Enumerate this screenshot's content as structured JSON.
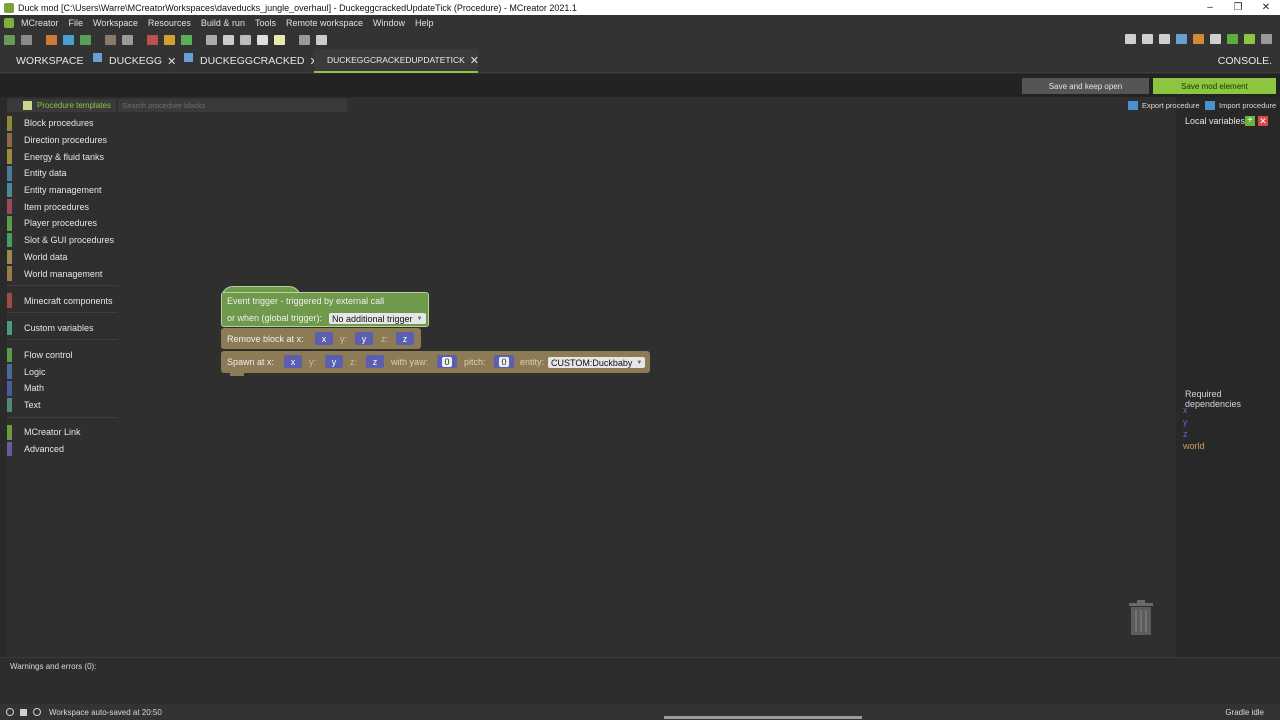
{
  "window": {
    "title": "Duck mod [C:\\Users\\Warre\\MCreatorWorkspaces\\daveducks_jungle_overhaul] - DuckeggcrackedUpdateTick (Procedure) - MCreator 2021.1"
  },
  "menu": [
    "MCreator",
    "File",
    "Workspace",
    "Resources",
    "Build & run",
    "Tools",
    "Remote workspace",
    "Window",
    "Help"
  ],
  "tabs": {
    "workspace": "WORKSPACE",
    "t1": "DUCKEGG",
    "t2": "DUCKEGGCRACKED",
    "t3": "DUCKEGGCRACKEDUPDATETICK",
    "console": "CONSOLE."
  },
  "editor": {
    "save_keep_label": "Save and keep open",
    "save_label": "Save mod element"
  },
  "palette": {
    "templates_label": "Procedure templates",
    "search_placeholder": "Search procedure blocks",
    "categories": [
      {
        "label": "Block procedures",
        "color": "#8b8b3a"
      },
      {
        "label": "Direction procedures",
        "color": "#8b6b4a"
      },
      {
        "label": "Energy & fluid tanks",
        "color": "#9b8b3a"
      },
      {
        "label": "Entity data",
        "color": "#4a7b9b"
      },
      {
        "label": "Entity management",
        "color": "#4a8b9b"
      },
      {
        "label": "Item procedures",
        "color": "#9b4a5b"
      },
      {
        "label": "Player procedures",
        "color": "#5b9b4a"
      },
      {
        "label": "Slot & GUI procedures",
        "color": "#4a9b6b"
      },
      {
        "label": "World data",
        "color": "#9b8b4a"
      },
      {
        "label": "World management",
        "color": "#9b7b4a"
      },
      {
        "label": "Minecraft components",
        "color": "#a04a4a"
      },
      {
        "label": "Custom variables",
        "color": "#4a9b7b"
      },
      {
        "label": "Flow control",
        "color": "#5b9b4a"
      },
      {
        "label": "Logic",
        "color": "#4a6b9b"
      },
      {
        "label": "Math",
        "color": "#4a5b9b"
      },
      {
        "label": "Text",
        "color": "#4a8b7b"
      },
      {
        "label": "MCreator Link",
        "color": "#6b9b3a"
      },
      {
        "label": "Advanced",
        "color": "#6b5b9b"
      }
    ]
  },
  "blocks": {
    "event": {
      "line1": "Event trigger - triggered by external call",
      "line2": "or when (global trigger):",
      "trigger": "No additional trigger"
    },
    "remove": {
      "label": "Remove block at x:",
      "y": "y:",
      "z": "z:",
      "vx": "x",
      "vy": "y",
      "vz": "z"
    },
    "spawn": {
      "label": "Spawn at x:",
      "y": "y:",
      "z": "z:",
      "vx": "x",
      "vy": "y",
      "vz": "z",
      "yaw_label": "with yaw:",
      "yaw": "0",
      "pitch_label": "pitch:",
      "pitch": "0",
      "entity_label": "entity:",
      "entity": "CUSTOM:Duckbaby"
    }
  },
  "right_panel": {
    "export": "Export procedure",
    "import": "Import procedure",
    "local_vars": "Local variables",
    "required_title": "Required dependencies",
    "deps": [
      {
        "name": "x",
        "color": "#5b6bd0"
      },
      {
        "name": "y",
        "color": "#5b6bd0"
      },
      {
        "name": "z",
        "color": "#5b6bd0"
      },
      {
        "name": "world",
        "color": "#c9a15b"
      }
    ]
  },
  "bottom": {
    "warnings": "Warnings and errors (0):",
    "status": "Workspace auto-saved at 20:50",
    "gradle": "Gradle idle"
  }
}
